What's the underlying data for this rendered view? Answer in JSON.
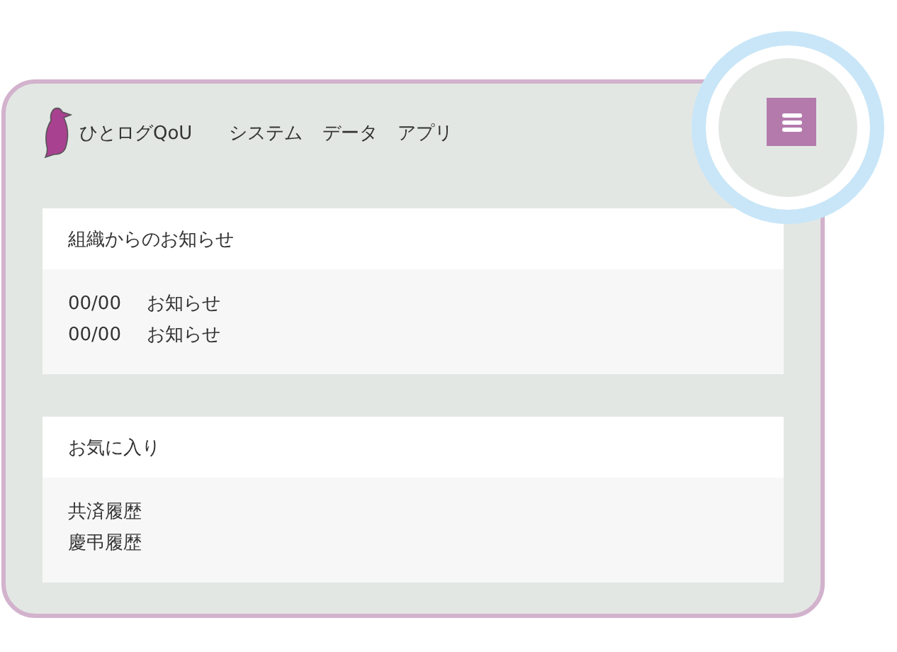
{
  "header": {
    "app_name": "ひとログQoU",
    "nav": [
      "システム",
      "データ",
      "アプリ"
    ]
  },
  "sections": [
    {
      "title": "組織からのお知らせ",
      "items": [
        {
          "date": "00/00",
          "text": "お知らせ"
        },
        {
          "date": "00/00",
          "text": "お知らせ"
        }
      ]
    },
    {
      "title": "お気に入り",
      "items": [
        {
          "text": "共済履歴"
        },
        {
          "text": "慶弔履歴"
        }
      ]
    }
  ]
}
